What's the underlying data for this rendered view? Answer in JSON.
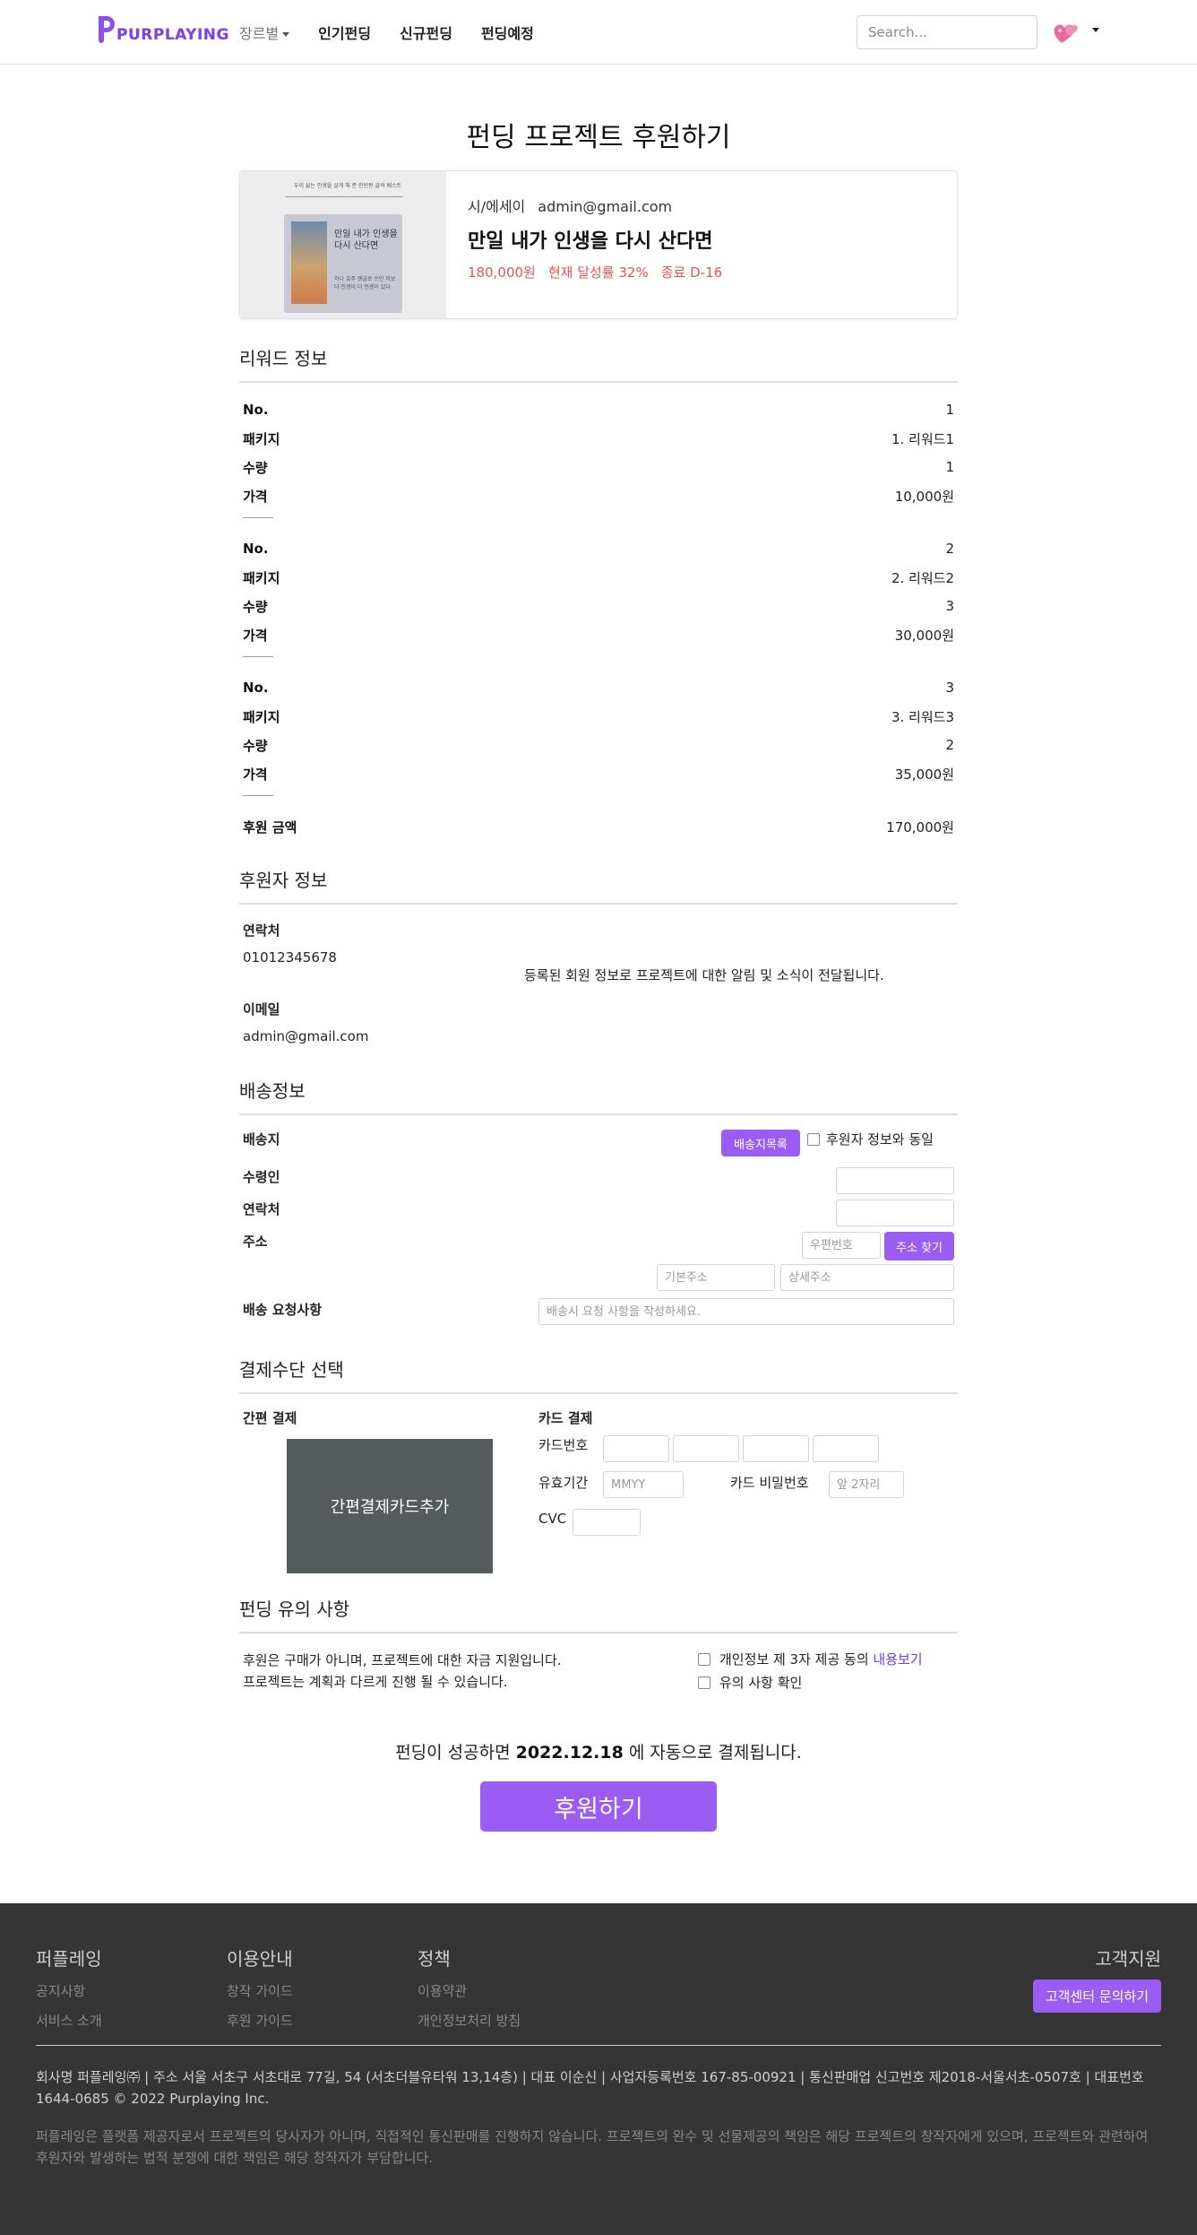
{
  "nav": {
    "logo": "PURPLAYING",
    "genre": "장르별",
    "popular": "인기펀딩",
    "new": "신규펀딩",
    "upcoming": "펀딩예정",
    "search_placeholder": "Search..."
  },
  "page_title": "펀딩 프로젝트 후원하기",
  "project": {
    "cover_banner": "우리 삶는 인생을 살게 해 준 인턴판 골의 베스트",
    "cover_book_title": "만일 내가 인생을 다시 산다면",
    "cover_book_sub": "하나 효주 쟁글로 쓰인 저보다 인생이 더 인센이 있다",
    "category": "시/에세이",
    "author": "admin@gmail.com",
    "name": "만일 내가 인생을 다시 산다면",
    "goal": "180,000원",
    "rate": "현재 달성률 32%",
    "deadline": "종료 D-16"
  },
  "reward": {
    "title": "리워드 정보",
    "labels": {
      "no": "No.",
      "package": "패키지",
      "qty": "수량",
      "price": "가격"
    },
    "items": [
      {
        "no": "1",
        "package": "1. 리워드1",
        "qty": "1",
        "price": "10,000원"
      },
      {
        "no": "2",
        "package": "2. 리워드2",
        "qty": "3",
        "price": "30,000원"
      },
      {
        "no": "3",
        "package": "3. 리워드3",
        "qty": "2",
        "price": "35,000원"
      }
    ],
    "total_label": "후원 금액",
    "total_value": "170,000원"
  },
  "backer": {
    "title": "후원자 정보",
    "contact_label": "연락처",
    "contact_value": "01012345678",
    "email_label": "이메일",
    "email_value": "admin@gmail.com",
    "note": "등록된 회원 정보로 프로젝트에 대한 알림 및 소식이 전달됩니다."
  },
  "shipping": {
    "title": "배송정보",
    "dest_label": "배송지",
    "list_button": "배송지목록",
    "same_as_backer": "후원자 정보와 동일",
    "recipient_label": "수령인",
    "contact_label": "연락처",
    "address_label": "주소",
    "zip_placeholder": "우편번호",
    "find_address": "주소 찾기",
    "base_addr_placeholder": "기본주소",
    "detail_addr_placeholder": "상세주소",
    "request_label": "배송 요청사항",
    "request_placeholder": "배송시 요청 사항을 작성하세요."
  },
  "payment": {
    "title": "결제수단 선택",
    "easy_label": "간편 결제",
    "easy_add": "간편결제카드추가",
    "card_label": "카드 결제",
    "card_no": "카드번호",
    "expiry": "유효기간",
    "expiry_placeholder": "MMYY",
    "card_pw": "카드 비밀번호",
    "card_pw_placeholder": "앞 2자리",
    "cvc": "CVC"
  },
  "notice": {
    "title": "펀딩 유의 사항",
    "line1": "후원은 구매가 아니며, 프로젝트에 대한 자금 지원입니다.",
    "line2": "프로젝트는 계획과 다르게 진행 될 수 있습니다.",
    "agree_privacy": "개인정보 제 3자 제공 동의",
    "view_link": "내용보기",
    "agree_notice": "유의 사항 확인"
  },
  "auto_pay": {
    "prefix": "펀딩이 성공하면",
    "date": "2022.12.18",
    "suffix": "에 자동으로 결제됩니다."
  },
  "submit": "후원하기",
  "footer": {
    "col1": {
      "title": "퍼플레잉",
      "items": [
        "공지사항",
        "서비스 소개"
      ]
    },
    "col2": {
      "title": "이용안내",
      "items": [
        "창작 가이드",
        "후원 가이드"
      ]
    },
    "col3": {
      "title": "정책",
      "items": [
        "이용약관",
        "개인정보처리 방침"
      ]
    },
    "support_title": "고객지원",
    "support_button": "고객센터 문의하기",
    "info": "회사명 퍼플레잉㈜ | 주소 서울 서초구 서초대로 77길, 54 (서초더블유타워 13,14층) | 대표 이순신 | 사업자등록번호 167-85-00921 | 통신판매업 신고번호 제2018-서울서초-0507호 | 대표번호 1644-0685 © 2022 Purplaying Inc.",
    "disclaimer": "퍼플레잉은 플랫폼 제공자로서 프로젝트의 당사자가 아니며, 직접적인 통신판매를 진행하지 않습니다. 프로젝트의 완수 및 선물제공의 책임은 해당 프로젝트의 창작자에게 있으며, 프로젝트와 관련하여 후원자와 발생하는 법적 분쟁에 대한 책임은 해당 창작자가 부담합니다."
  }
}
